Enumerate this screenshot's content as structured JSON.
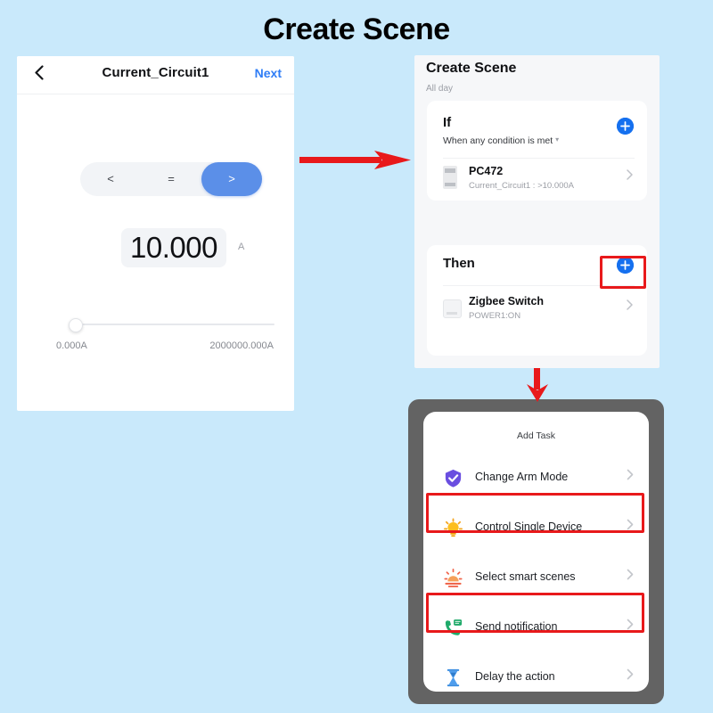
{
  "page": {
    "title": "Create Scene",
    "background_color": "#c9e9fb"
  },
  "left_phone": {
    "navbar": {
      "back_icon": "chevron-left-icon",
      "title": "Current_Circuit1",
      "next_label": "Next"
    },
    "comparison": {
      "options": [
        "<",
        "=",
        ">"
      ],
      "selected": ">",
      "selected_color": "#5b8fe8"
    },
    "value": {
      "number": "10.000",
      "unit": "A"
    },
    "slider": {
      "min_label": "0.000A",
      "max_label": "2000000.000A",
      "position_percent": 0
    }
  },
  "mid_phone": {
    "title": "Create Scene",
    "subtitle": "All day",
    "if_card": {
      "label": "If",
      "condition": "When any condition is met",
      "caret_icon": "caret-down-icon",
      "add_icon": "plus-circle-icon",
      "add_color": "#1570ef",
      "device": {
        "icon": "din-rail-meter-icon",
        "name": "PC472",
        "description": "Current_Circuit1 : >10.000A",
        "chevron_icon": "chevron-right-icon"
      }
    },
    "then_card": {
      "label": "Then",
      "add_icon": "plus-circle-icon",
      "add_color": "#1570ef",
      "highlighted": true,
      "device": {
        "icon": "zigbee-switch-icon",
        "name": "Zigbee Switch",
        "description": "POWER1:ON",
        "chevron_icon": "chevron-right-icon"
      }
    }
  },
  "task_phone": {
    "sheet_title": "Add Task",
    "items": [
      {
        "label": "Change Arm Mode",
        "icon": "shield-check-icon",
        "icon_color": "#6a4ee0",
        "highlighted": false,
        "chevron_icon": "chevron-right-icon"
      },
      {
        "label": "Control Single Device",
        "icon": "light-bulb-icon",
        "icon_color": "#f5a623",
        "highlighted": true,
        "chevron_icon": "chevron-right-icon"
      },
      {
        "label": "Select smart scenes",
        "icon": "sunrise-scene-icon",
        "icon_color": "#f0634a",
        "highlighted": false,
        "chevron_icon": "chevron-right-icon"
      },
      {
        "label": "Send notification",
        "icon": "phone-message-icon",
        "icon_color": "#1faa6a",
        "highlighted": true,
        "chevron_icon": "chevron-right-icon"
      },
      {
        "label": "Delay the action",
        "icon": "hourglass-icon",
        "icon_color": "#3a8de0",
        "highlighted": false,
        "chevron_icon": "chevron-right-icon"
      }
    ]
  },
  "annotations": {
    "arrow_color": "#e8191b",
    "highlight_color": "#e8191b",
    "arrow_horizontal": "arrow-right-icon",
    "arrow_vertical": "arrow-down-icon"
  }
}
